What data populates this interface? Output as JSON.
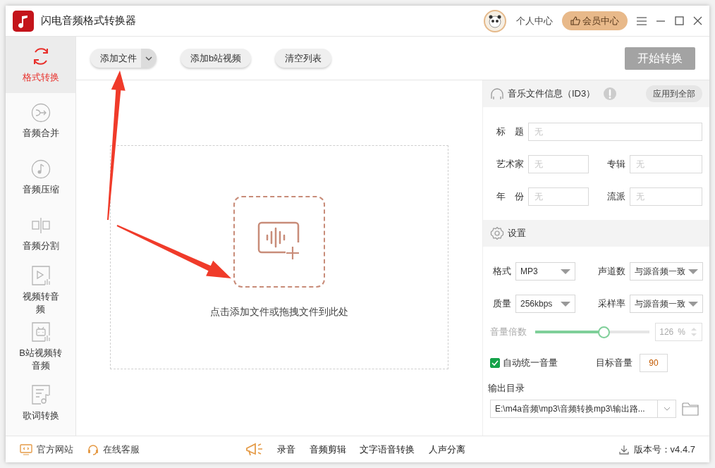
{
  "window": {
    "title": "闪电音频格式转换器"
  },
  "header": {
    "user_center": "个人中心",
    "vip_center": "会员中心"
  },
  "sidebar": {
    "items": [
      {
        "label": "格式转换",
        "kind": "convert",
        "selected": true
      },
      {
        "label": "音频合并",
        "kind": "merge",
        "selected": false
      },
      {
        "label": "音频压缩",
        "kind": "compress",
        "selected": false
      },
      {
        "label": "音频分割",
        "kind": "split",
        "selected": false
      },
      {
        "label": "视频转音频",
        "kind": "video",
        "selected": false
      },
      {
        "label": "B站视频转音频",
        "kind": "bilibili",
        "selected": false
      },
      {
        "label": "歌词转换",
        "kind": "lyrics",
        "selected": false
      }
    ]
  },
  "toolbar": {
    "add_file": "添加文件",
    "add_bilibili": "添加b站视频",
    "clear_list": "清空列表",
    "start": "开始转换"
  },
  "drop_zone": {
    "hint": "点击添加文件或拖拽文件到此处"
  },
  "id3": {
    "title": "音乐文件信息（ID3）",
    "apply_all": "应用到全部",
    "rows": [
      [
        {
          "label": "标　题",
          "placeholder": "无"
        }
      ],
      [
        {
          "label": "艺术家",
          "placeholder": "无"
        },
        {
          "label": "专辑",
          "placeholder": "无"
        }
      ],
      [
        {
          "label": "年　份",
          "placeholder": "无"
        },
        {
          "label": "流派",
          "placeholder": "无"
        }
      ]
    ]
  },
  "settings": {
    "title": "设置",
    "selects": [
      {
        "label": "格式",
        "value": "MP3"
      },
      {
        "label": "声道数",
        "value": "与源音频一致"
      },
      {
        "label": "质量",
        "value": "256kbps"
      },
      {
        "label": "采样率",
        "value": "与源音频一致"
      }
    ],
    "volume": {
      "label": "音量倍数",
      "level": 0.61,
      "value": "126",
      "unit": "%",
      "disabled": true
    },
    "auto_normalize": {
      "label": "自动统一音量",
      "checked": true
    },
    "target_volume": {
      "label": "目标音量",
      "value": "90"
    },
    "output": {
      "label": "输出目录",
      "path": "E:\\m4a音频\\mp3\\音频转换mp3\\输出路..."
    }
  },
  "footer": {
    "links": [
      {
        "label": "官方网站",
        "kind": "monitor"
      },
      {
        "label": "在线客服",
        "kind": "headset"
      }
    ],
    "tools": [
      "录音",
      "音频剪辑",
      "文字语音转换",
      "人声分离"
    ],
    "version": "版本号：v4.4.7"
  }
}
